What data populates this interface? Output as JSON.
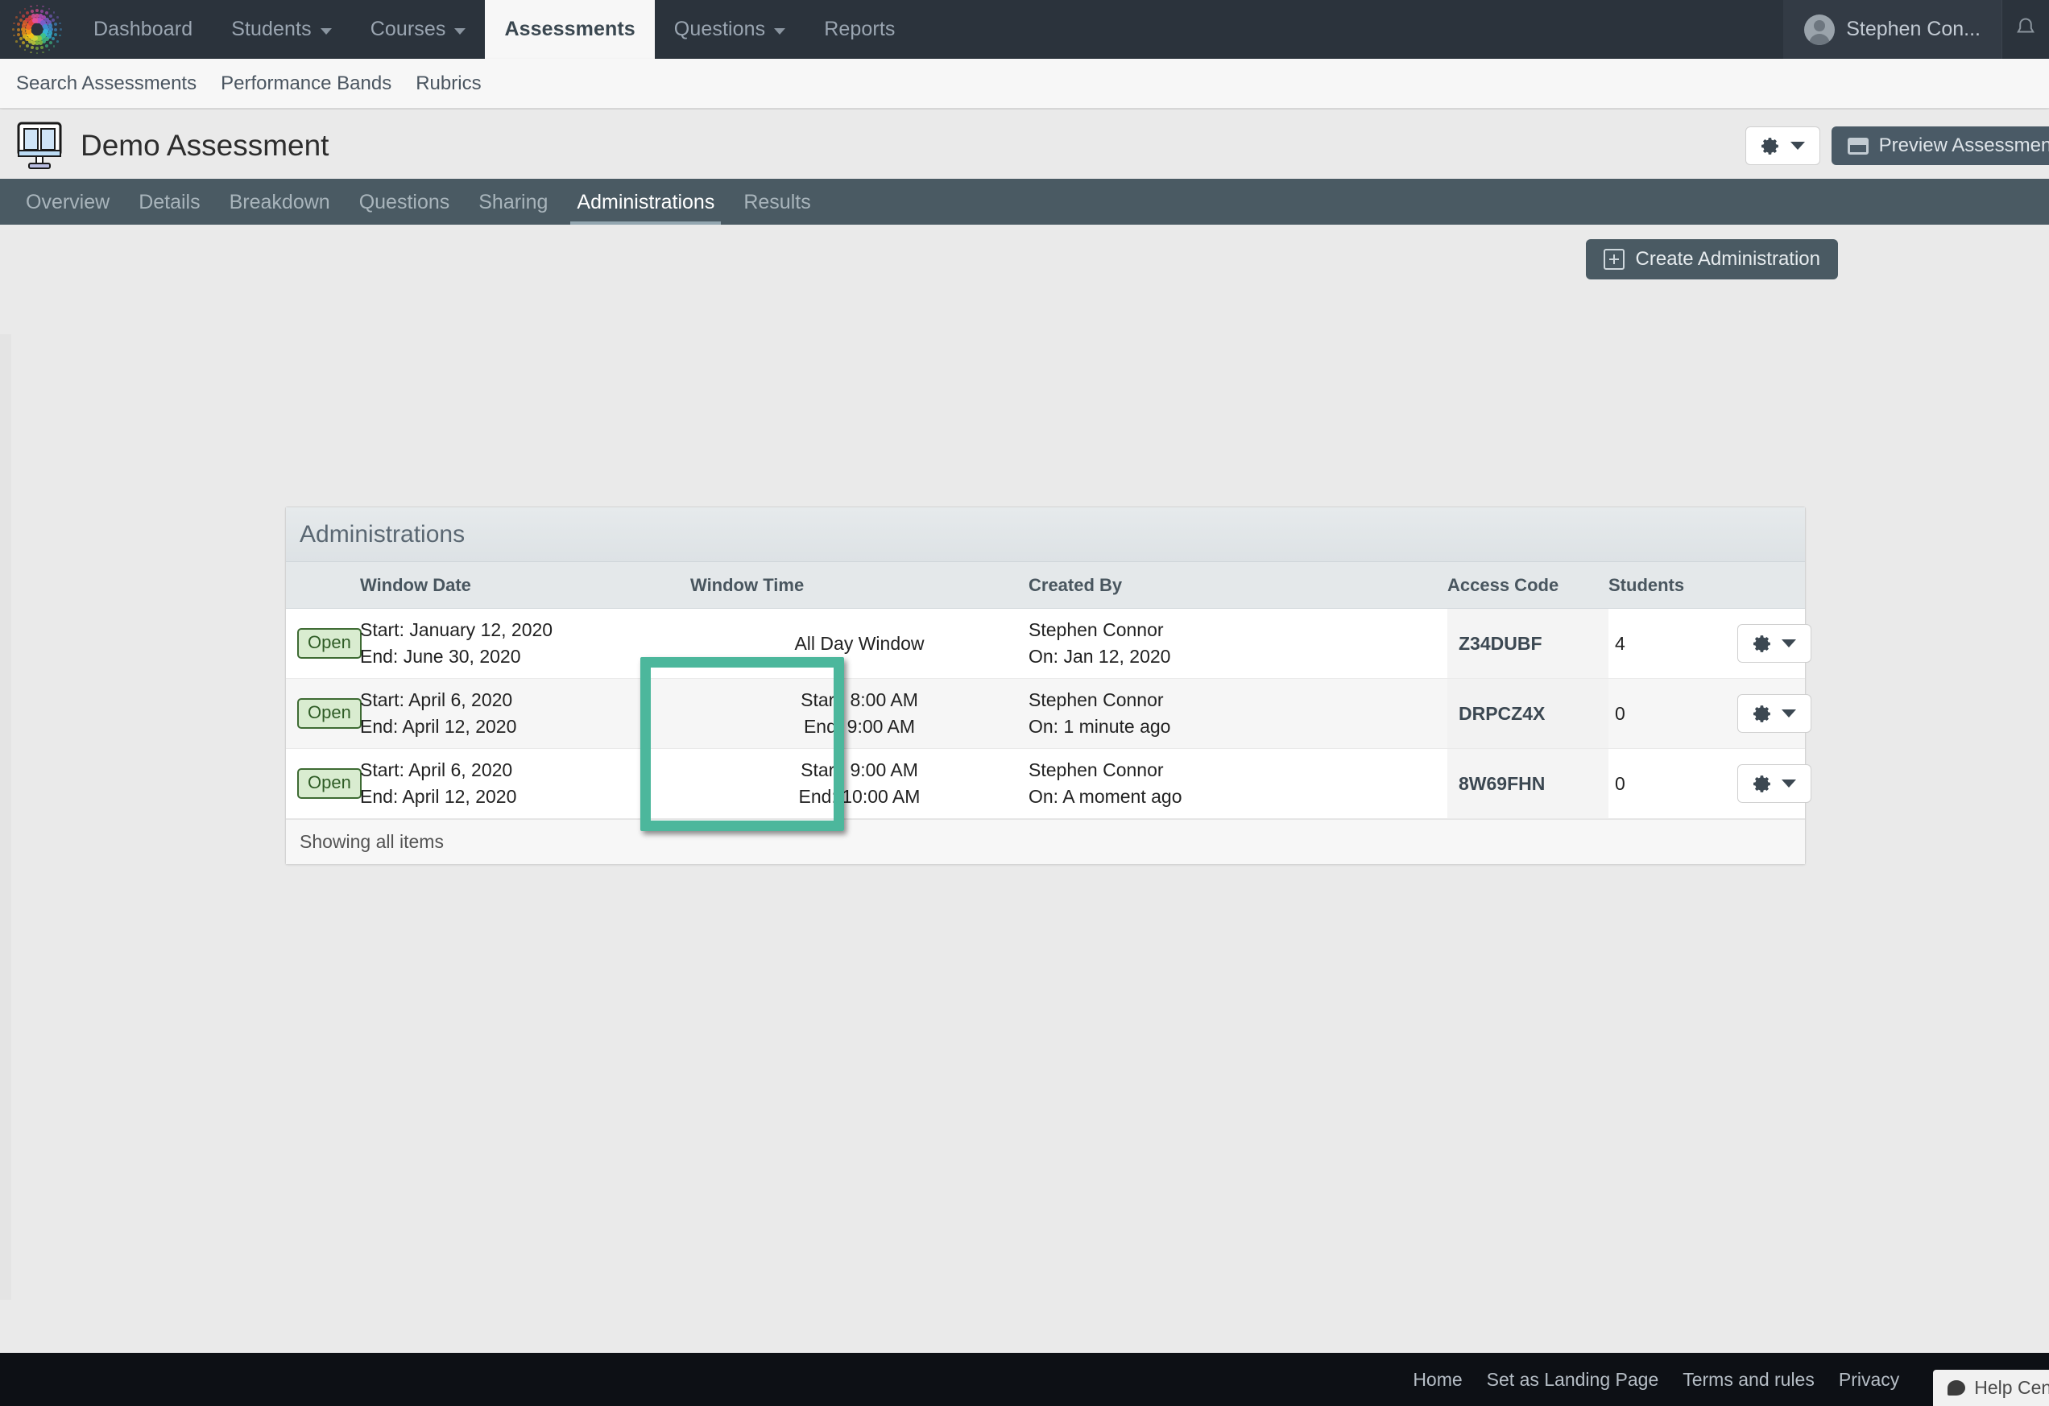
{
  "topnav": {
    "logo_name": "prism-logo",
    "items": [
      {
        "label": "Dashboard",
        "has_caret": false,
        "active": false
      },
      {
        "label": "Students",
        "has_caret": true,
        "active": false
      },
      {
        "label": "Courses",
        "has_caret": true,
        "active": false
      },
      {
        "label": "Assessments",
        "has_caret": false,
        "active": true
      },
      {
        "label": "Questions",
        "has_caret": true,
        "active": false
      },
      {
        "label": "Reports",
        "has_caret": false,
        "active": false
      }
    ],
    "user_name": "Stephen Con...",
    "bell_icon": "notification-bell-icon"
  },
  "subnav": {
    "items": [
      {
        "label": "Search Assessments"
      },
      {
        "label": "Performance Bands"
      },
      {
        "label": "Rubrics"
      }
    ]
  },
  "titlebar": {
    "icon": "assessment-document-icon",
    "title": "Demo Assessment",
    "gear_button": "settings-gear",
    "preview_label": "Preview Assessment"
  },
  "tabs": [
    {
      "label": "Overview",
      "active": false
    },
    {
      "label": "Details",
      "active": false
    },
    {
      "label": "Breakdown",
      "active": false
    },
    {
      "label": "Questions",
      "active": false
    },
    {
      "label": "Sharing",
      "active": false
    },
    {
      "label": "Administrations",
      "active": true
    },
    {
      "label": "Results",
      "active": false
    }
  ],
  "main": {
    "create_button_label": "Create Administration",
    "panel_title": "Administrations",
    "columns": [
      {
        "key": "status",
        "label": ""
      },
      {
        "key": "window_date",
        "label": "Window Date"
      },
      {
        "key": "window_time",
        "label": "Window Time"
      },
      {
        "key": "created_by",
        "label": "Created By"
      },
      {
        "key": "access_code",
        "label": "Access Code"
      },
      {
        "key": "students",
        "label": "Students"
      },
      {
        "key": "actions",
        "label": ""
      }
    ],
    "rows": [
      {
        "status": "Open",
        "date_start": "Start: January 12, 2020",
        "date_end": "End: June 30, 2020",
        "time_start": "All Day Window",
        "time_end": "",
        "created_by_name": "Stephen Connor",
        "created_by_on": "On: Jan 12, 2020",
        "access_code": "Z34DUBF",
        "students": "4"
      },
      {
        "status": "Open",
        "date_start": "Start: April 6, 2020",
        "date_end": "End: April 12, 2020",
        "time_start": "Start: 8:00 AM",
        "time_end": "End: 9:00 AM",
        "created_by_name": "Stephen Connor",
        "created_by_on": "On: 1 minute ago",
        "access_code": "DRPCZ4X",
        "students": "0"
      },
      {
        "status": "Open",
        "date_start": "Start: April 6, 2020",
        "date_end": "End: April 12, 2020",
        "time_start": "Start: 9:00 AM",
        "time_end": "End: 10:00 AM",
        "created_by_name": "Stephen Connor",
        "created_by_on": "On: A moment ago",
        "access_code": "8W69FHN",
        "students": "0"
      }
    ],
    "footer_text": "Showing all items"
  },
  "annotation": {
    "type": "highlight-rectangle",
    "color": "#4cb79c",
    "targets": "window-time-column-cells"
  },
  "footer": {
    "links": [
      {
        "label": "Home"
      },
      {
        "label": "Set as Landing Page"
      },
      {
        "label": "Terms and rules"
      },
      {
        "label": "Privacy"
      }
    ],
    "help_label": "Help Center"
  }
}
